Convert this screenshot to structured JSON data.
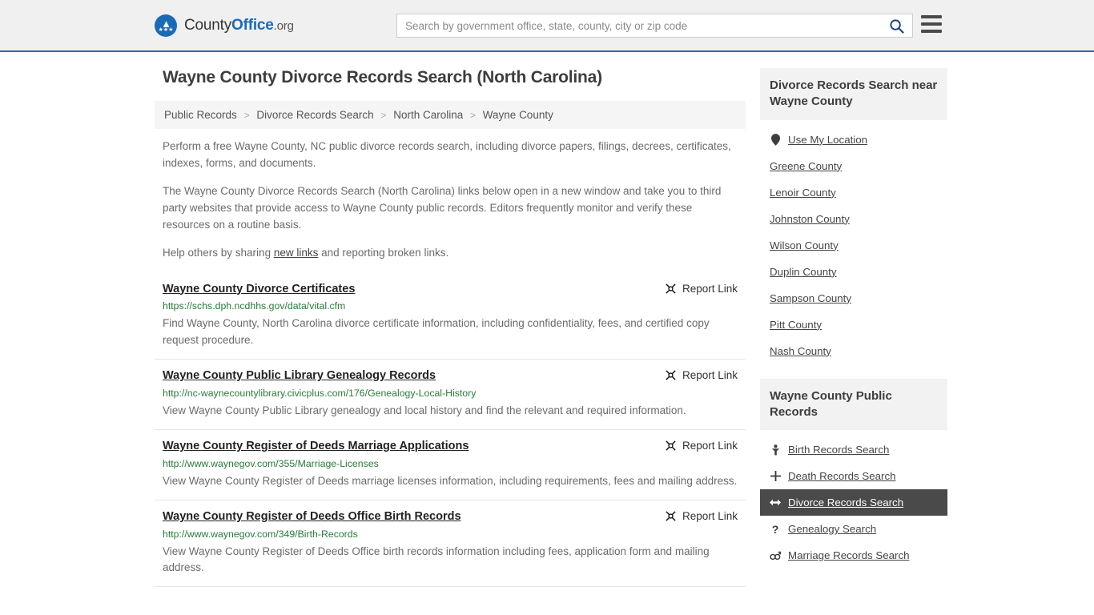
{
  "header": {
    "brand": {
      "part1": "County",
      "part2": "Office",
      "part3": ".org",
      "logo_icon": "eagle-seal-icon"
    },
    "search": {
      "placeholder": "Search by government office, state, county, city or zip code",
      "value": ""
    },
    "search_icon": "search-icon",
    "menu_icon": "hamburger-menu-icon"
  },
  "page": {
    "title": "Wayne County Divorce Records Search (North Carolina)"
  },
  "breadcrumb": {
    "items": [
      {
        "label": "Public Records"
      },
      {
        "label": "Divorce Records Search"
      },
      {
        "label": "North Carolina"
      },
      {
        "label": "Wayne County"
      }
    ],
    "separator": ">"
  },
  "intro": {
    "p1": "Perform a free Wayne County, NC public divorce records search, including divorce papers, filings, decrees, certificates, indexes, forms, and documents.",
    "p2": "The Wayne County Divorce Records Search (North Carolina) links below open in a new window and take you to third party websites that provide access to Wayne County public records. Editors frequently monitor and verify these resources on a routine basis.",
    "p3_before": "Help others by sharing ",
    "p3_link": "new links",
    "p3_after": " and reporting broken links."
  },
  "results": {
    "report_label": "Report Link",
    "report_icon": "broken-link-icon",
    "items": [
      {
        "title": "Wayne County Divorce Certificates",
        "url": "https://schs.dph.ncdhhs.gov/data/vital.cfm",
        "description": "Find Wayne County, North Carolina divorce certificate information, including confidentiality, fees, and certified copy request procedure."
      },
      {
        "title": "Wayne County Public Library Genealogy Records",
        "url": "http://nc-waynecountylibrary.civicplus.com/176/Genealogy-Local-History",
        "description": "View Wayne County Public Library genealogy and local history and find the relevant and required information."
      },
      {
        "title": "Wayne County Register of Deeds Marriage Applications",
        "url": "http://www.waynegov.com/355/Marriage-Licenses",
        "description": "View Wayne County Register of Deeds marriage licenses information, including requirements, fees and mailing address."
      },
      {
        "title": "Wayne County Register of Deeds Office Birth Records",
        "url": "http://www.waynegov.com/349/Birth-Records",
        "description": "View Wayne County Register of Deeds Office birth records information including fees, application form and mailing address."
      }
    ]
  },
  "sidebar": {
    "nearby": {
      "heading": "Divorce Records Search near Wayne County",
      "items": [
        {
          "label": "Use My Location",
          "icon": "map-pin-icon",
          "active": false
        },
        {
          "label": "Greene County",
          "icon": "",
          "active": false
        },
        {
          "label": "Lenoir County",
          "icon": "",
          "active": false
        },
        {
          "label": "Johnston County",
          "icon": "",
          "active": false
        },
        {
          "label": "Wilson County",
          "icon": "",
          "active": false
        },
        {
          "label": "Duplin County",
          "icon": "",
          "active": false
        },
        {
          "label": "Sampson County",
          "icon": "",
          "active": false
        },
        {
          "label": "Pitt County",
          "icon": "",
          "active": false
        },
        {
          "label": "Nash County",
          "icon": "",
          "active": false
        }
      ]
    },
    "public_records": {
      "heading": "Wayne County Public Records",
      "items": [
        {
          "label": "Birth Records Search",
          "icon": "baby-icon",
          "glyph": "Ɣ",
          "active": false
        },
        {
          "label": "Death Records Search",
          "icon": "cross-icon",
          "glyph": "✚",
          "active": false
        },
        {
          "label": "Divorce Records Search",
          "icon": "left-right-arrow-icon",
          "glyph": "↔",
          "active": true
        },
        {
          "label": "Genealogy Search",
          "icon": "question-mark-icon",
          "glyph": "?",
          "active": false
        },
        {
          "label": "Marriage Records Search",
          "icon": "male-female-icon",
          "glyph": "⚥",
          "active": false
        }
      ]
    }
  },
  "colors": {
    "brand_blue": "#1a6bb5",
    "header_border": "#2e6da4",
    "url_green": "#2a7a3b",
    "active_bg": "#4a4a4a"
  }
}
